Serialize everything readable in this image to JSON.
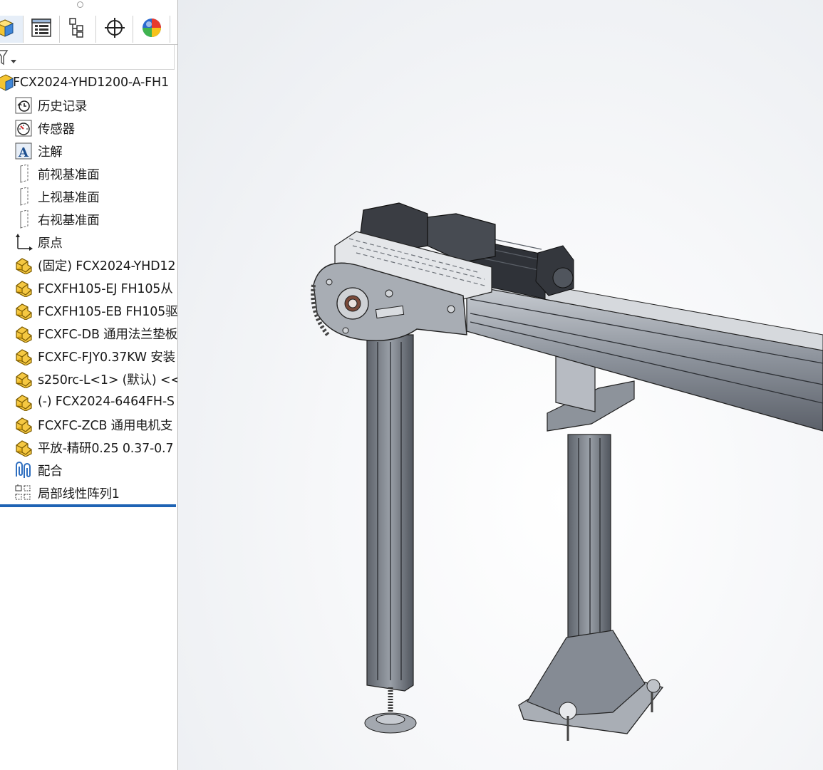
{
  "tabs": [
    {
      "icon": "feature-manager-icon",
      "active": true
    },
    {
      "icon": "property-manager-icon",
      "active": false
    },
    {
      "icon": "configuration-manager-icon",
      "active": false
    },
    {
      "icon": "dimxpert-manager-icon",
      "active": false
    },
    {
      "icon": "display-manager-icon",
      "active": false
    }
  ],
  "filter": {
    "icon": "filter-icon"
  },
  "tree": {
    "root": "FCX2024-YHD1200-A-FH1",
    "items": [
      {
        "label": "历史记录",
        "icon": "history-icon"
      },
      {
        "label": "传感器",
        "icon": "sensor-icon"
      },
      {
        "label": "注解",
        "icon": "annotation-icon"
      },
      {
        "label": "前视基准面",
        "icon": "plane-icon"
      },
      {
        "label": "上视基准面",
        "icon": "plane-icon"
      },
      {
        "label": "右视基准面",
        "icon": "plane-icon"
      },
      {
        "label": "原点",
        "icon": "origin-icon"
      },
      {
        "label": "(固定) FCX2024-YHD12",
        "icon": "assembly-icon"
      },
      {
        "label": "FCXFH105-EJ FH105从",
        "icon": "assembly-icon"
      },
      {
        "label": "FCXFH105-EB FH105驱",
        "icon": "assembly-icon"
      },
      {
        "label": "FCXFC-DB 通用法兰垫板",
        "icon": "assembly-icon"
      },
      {
        "label": "FCXFC-FJY0.37KW 安装",
        "icon": "assembly-icon"
      },
      {
        "label": "s250rc-L<1> (默认) <<",
        "icon": "assembly-icon"
      },
      {
        "label": "(-) FCX2024-6464FH-S",
        "icon": "assembly-icon"
      },
      {
        "label": "FCXFC-ZCB   通用电机支",
        "icon": "assembly-icon"
      },
      {
        "label": "平放-精研0.25 0.37-0.7",
        "icon": "assembly-icon"
      },
      {
        "label": "配合",
        "icon": "mates-icon"
      },
      {
        "label": "局部线性阵列1",
        "icon": "linear-pattern-icon"
      }
    ]
  },
  "colors": {
    "accent": "#1e63b4",
    "model_body": "#6e7480",
    "model_plate": "#a7acb4",
    "model_dark": "#2c2f33"
  }
}
